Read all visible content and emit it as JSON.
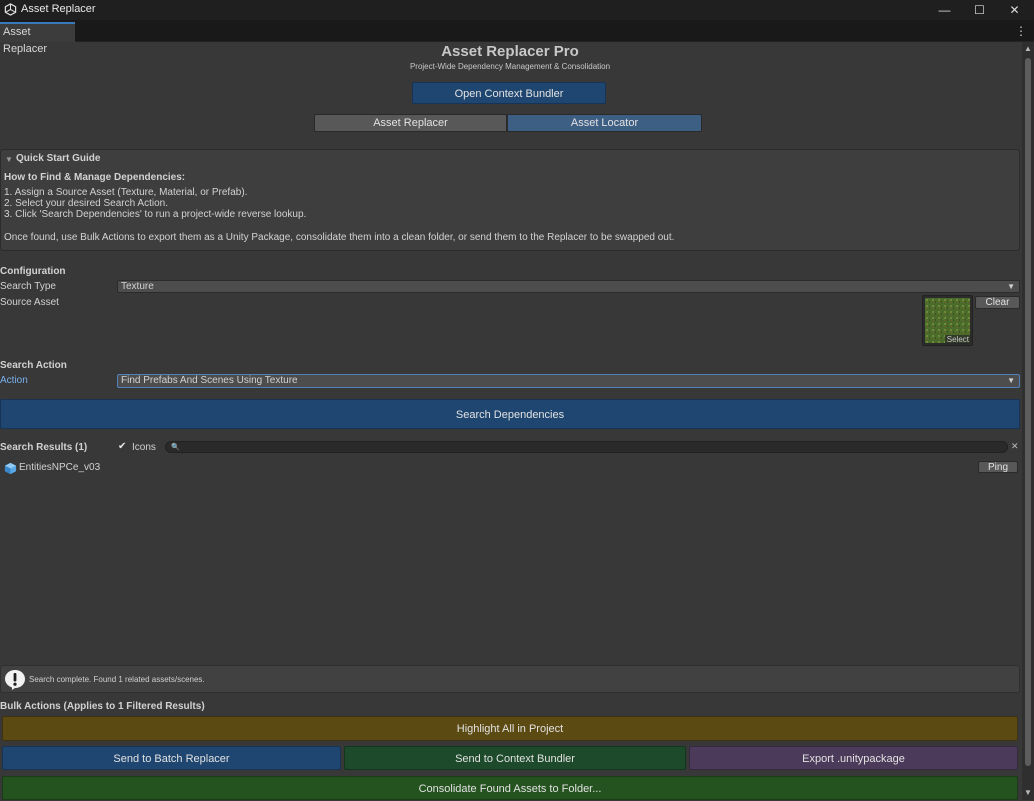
{
  "window": {
    "title": "Asset Replacer"
  },
  "tab": {
    "label": "Asset Replacer"
  },
  "header": {
    "title": "Asset Replacer Pro",
    "subtitle": "Project-Wide Dependency Management & Consolidation",
    "open_bundler_label": "Open Context Bundler"
  },
  "mode_tabs": [
    {
      "label": "Asset Replacer",
      "selected": false
    },
    {
      "label": "Asset Locator",
      "selected": true
    }
  ],
  "guide": {
    "heading": "Quick Start Guide",
    "subheading": "How to Find & Manage Dependencies:",
    "lines": [
      "1. Assign a Source Asset (Texture, Material, or Prefab).",
      "2. Select your desired Search Action.",
      "3. Click 'Search Dependencies' to run a project-wide reverse lookup."
    ],
    "footer": "Once found, use Bulk Actions to export them as a Unity Package, consolidate them into a clean folder, or send them to the Replacer to be swapped out."
  },
  "config": {
    "heading": "Configuration",
    "search_type_label": "Search Type",
    "search_type_value": "Texture",
    "source_asset_label": "Source Asset",
    "select_label": "Select",
    "clear_label": "Clear"
  },
  "search_action": {
    "heading": "Search Action",
    "action_label": "Action",
    "action_value": "Find Prefabs And Scenes Using Texture",
    "search_button": "Search Dependencies"
  },
  "results": {
    "heading": "Search Results (1)",
    "icons_label": "Icons",
    "icons_checked": true,
    "search_value": "",
    "items": [
      {
        "name": "EntitiesNPCe_v03",
        "ping_label": "Ping"
      }
    ]
  },
  "status": {
    "message": "Search complete. Found 1 related assets/scenes."
  },
  "bulk": {
    "heading": "Bulk Actions (Applies to 1 Filtered Results)",
    "highlight_label": "Highlight All in Project",
    "send_batch_label": "Send to Batch Replacer",
    "send_bundler_label": "Send to Context Bundler",
    "export_label": "Export .unitypackage",
    "consolidate_label": "Consolidate Found Assets to Folder..."
  },
  "colors": {
    "bg": "#383838",
    "accent_blue": "#1f4670",
    "tab_selected": "#3e5f84",
    "highlight": "#5c4a13",
    "bundler_green": "#1c4a2a",
    "export_purple": "#4b3a5a",
    "consolidate_green": "#24531f"
  }
}
